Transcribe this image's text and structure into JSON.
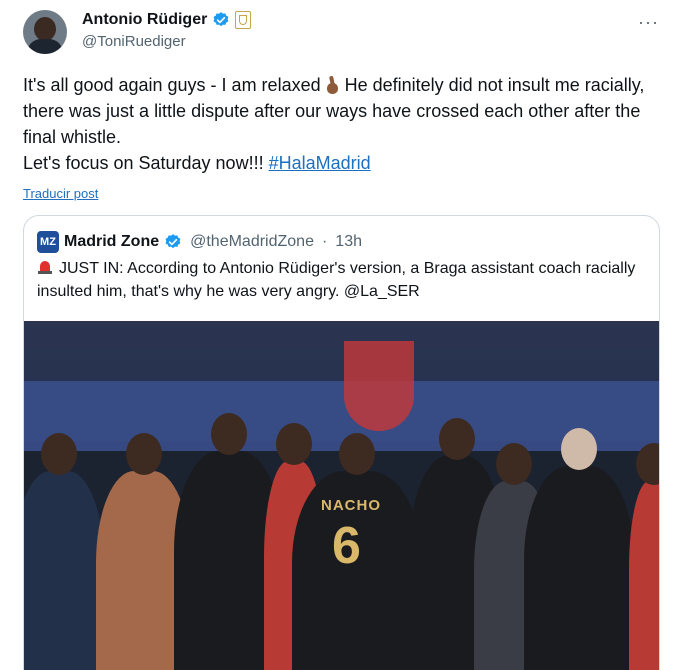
{
  "tweet": {
    "author_name": "Antonio Rüdiger",
    "author_handle": "@ToniRuediger",
    "more_label": "···",
    "text_line1_a": "It's all good again guys - I am relaxed",
    "text_line1_b": "He definitely did not insult me racially, there was just a little dispute after our ways have crossed each other after the final whistle.",
    "text_line2": "Let's focus on Saturday now!!!",
    "hashtag": "#HalaMadrid",
    "translate_label": "Traducir post"
  },
  "quote": {
    "logo_text": "MZ",
    "name": "Madrid Zone",
    "handle": "@theMadridZone",
    "separator": "·",
    "time": "13h",
    "text": "JUST IN: According to Antonio Rüdiger's version, a Braga assistant coach racially insulted him, that's why he was very angry. @La_SER",
    "photo": {
      "jersey_name": "NACHO",
      "jersey_number": "6"
    }
  },
  "icons": {
    "verified": "verified-badge-icon",
    "club": "real-madrid-crest-icon",
    "hand": "crossed-fingers-emoji",
    "siren": "siren-emoji"
  },
  "colors": {
    "verified_blue": "#1d9bf0",
    "link_blue": "#1d6fbf",
    "muted_text": "#536471"
  }
}
